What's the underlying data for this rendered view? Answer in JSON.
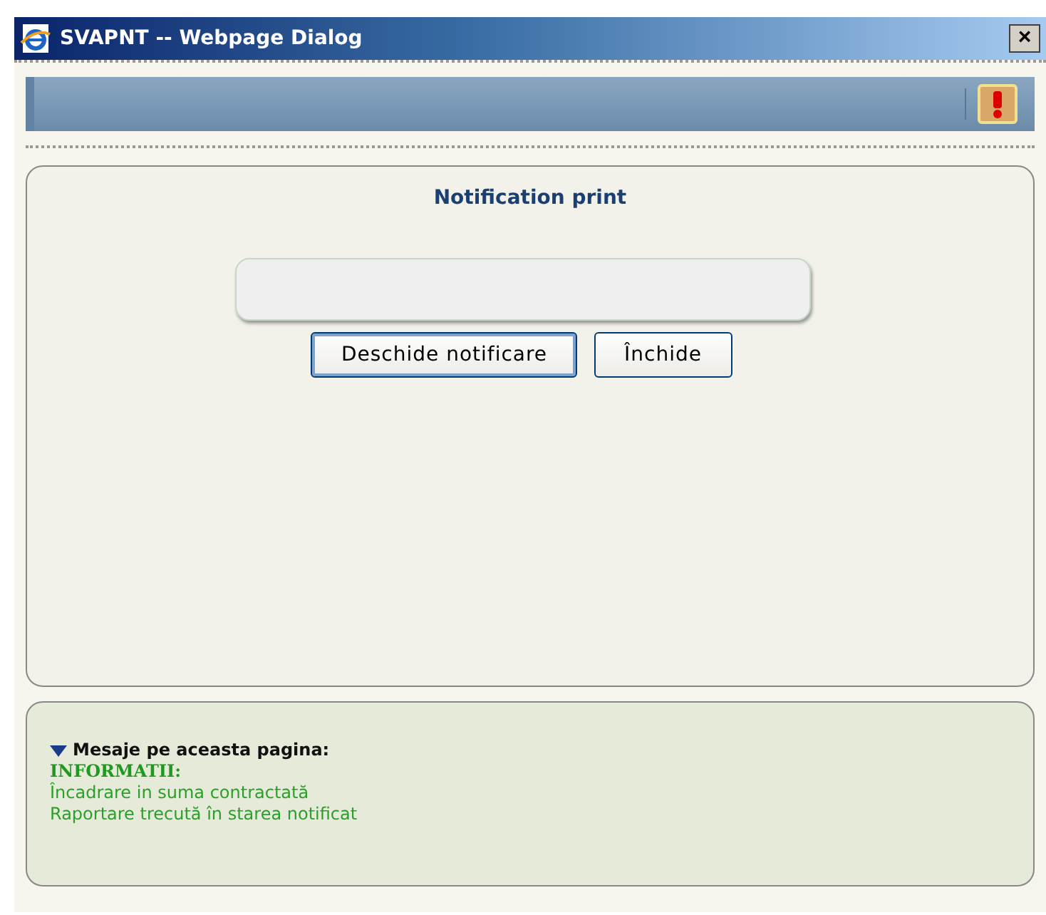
{
  "window": {
    "title": "SVAPNT -- Webpage Dialog",
    "close": "×"
  },
  "form": {
    "heading": "Notification print",
    "buttons": [
      {
        "label": "Deschide notificare",
        "focused": true
      },
      {
        "label": "Închide",
        "focused": false
      }
    ]
  },
  "messages": {
    "heading": "Mesaje pe aceasta pagina:",
    "category": "INFORMATII:",
    "lines": [
      "Încadrare in suma contractată",
      "Raportare trecută în starea notificat"
    ]
  }
}
